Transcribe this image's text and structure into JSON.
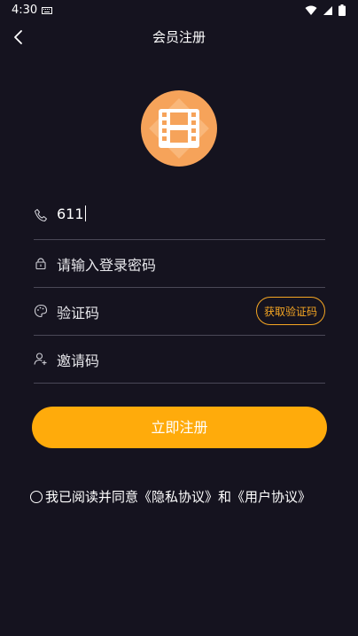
{
  "status_bar": {
    "time": "4:30"
  },
  "header": {
    "title": "会员注册"
  },
  "form": {
    "phone_value": "611",
    "password_placeholder": "请输入登录密码",
    "code_placeholder": "验证码",
    "code_button": "获取验证码",
    "invite_placeholder": "邀请码"
  },
  "submit_label": "立即注册",
  "agreement": {
    "prefix": "我已阅读并同意",
    "privacy": "《隐私协议》",
    "and": "和",
    "user": "《用户协议》"
  },
  "colors": {
    "background": "#15131f",
    "accent": "#ffab0b",
    "outline": "#f5a623"
  }
}
